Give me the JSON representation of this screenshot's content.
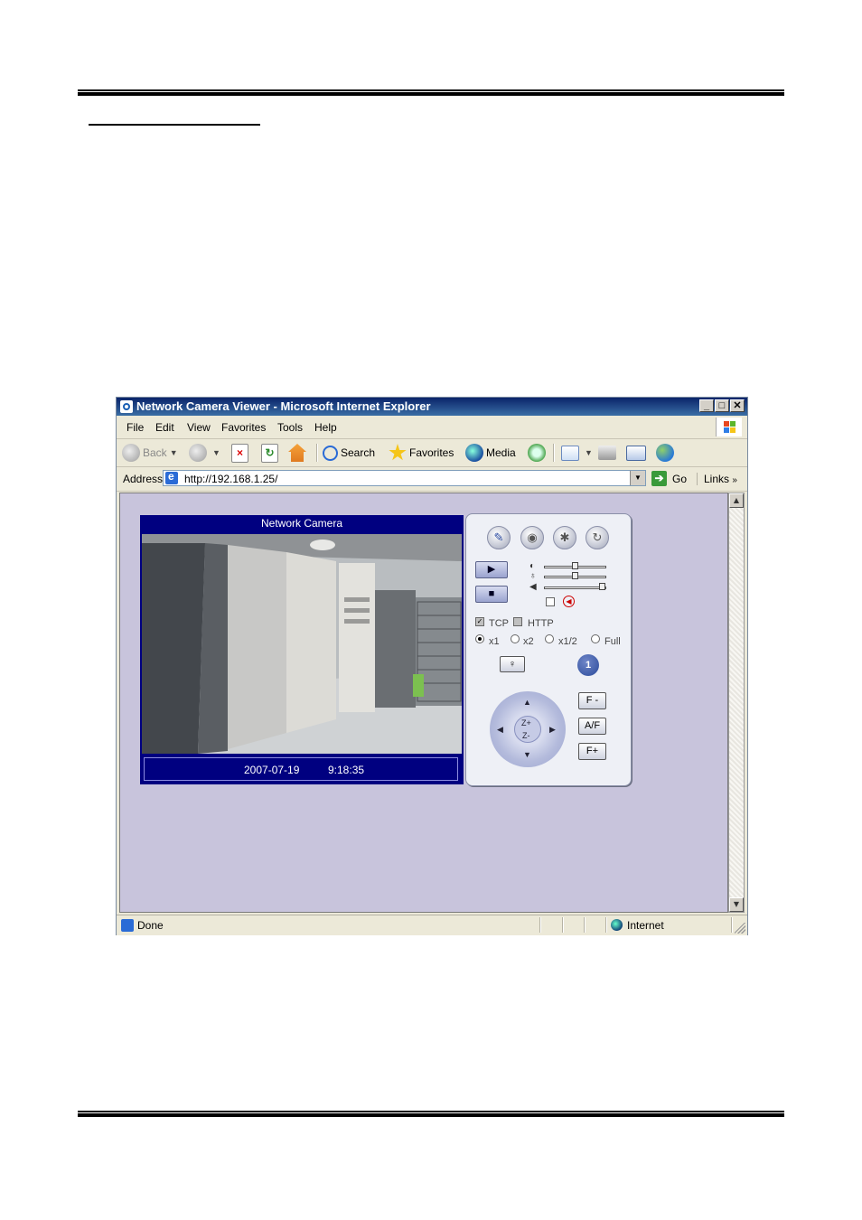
{
  "window": {
    "title": "Network Camera Viewer - Microsoft Internet Explorer",
    "controls": [
      "_",
      "□",
      "✕"
    ]
  },
  "menu": [
    "File",
    "Edit",
    "View",
    "Favorites",
    "Tools",
    "Help"
  ],
  "toolbar": {
    "back_label": "Back",
    "search_label": "Search",
    "favorites_label": "Favorites",
    "media_label": "Media"
  },
  "address": {
    "label": "Address",
    "url": "http://192.168.1.25/",
    "go_label": "Go",
    "links_label": "Links"
  },
  "viewer": {
    "title": "Network Camera",
    "date": "2007-07-19",
    "time": "9:18:35"
  },
  "panel": {
    "tcp_label": "TCP",
    "http_label": "HTTP",
    "tcp_checked": true,
    "http_checked": false,
    "sizes": [
      "x1",
      "x2",
      "x1/2",
      "Full"
    ],
    "selected_size": "x1",
    "channel": "1",
    "ptz_zoom_in": "Z+",
    "ptz_zoom_out": "Z-",
    "focus_minus": "F -",
    "autofocus": "A/F",
    "focus_plus": "F+",
    "brightness_level": 0.5,
    "contrast_level": 0.5,
    "volume_level": 1.0
  },
  "status": {
    "text": "Done",
    "zone": "Internet"
  }
}
